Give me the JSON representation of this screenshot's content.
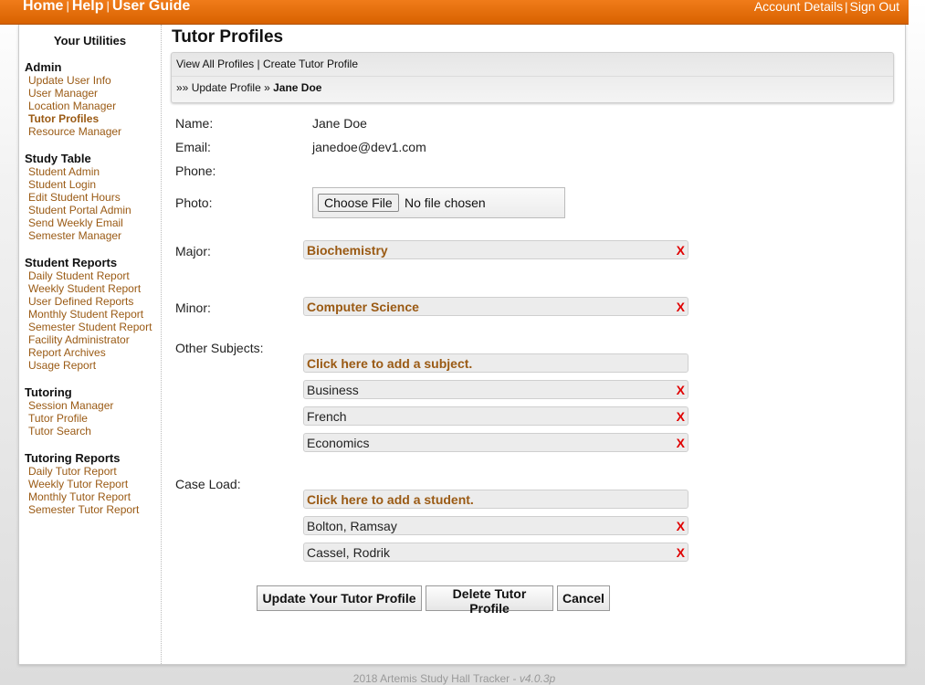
{
  "topbar": {
    "home": "Home",
    "help": "Help",
    "user_guide": "User Guide",
    "account_details": "Account Details",
    "sign_out": "Sign Out",
    "sep": "|"
  },
  "sidebar": {
    "title": "Your Utilities",
    "sections": [
      {
        "heading": "Admin",
        "items": [
          "Update User Info",
          "User Manager",
          "Location Manager",
          "Tutor Profiles",
          "Resource Manager"
        ]
      },
      {
        "heading": "Study Table",
        "items": [
          "Student Admin",
          "Student Login",
          "Edit Student Hours",
          "Student Portal Admin",
          "Send Weekly Email",
          "Semester Manager"
        ]
      },
      {
        "heading": "Student Reports",
        "items": [
          "Daily Student Report",
          "Weekly Student Report",
          "User Defined Reports",
          "Monthly Student Report",
          "Semester Student Report",
          "Facility Administrator",
          "Report Archives",
          "Usage Report"
        ]
      },
      {
        "heading": "Tutoring",
        "items": [
          "Session Manager",
          "Tutor Profile",
          "Tutor Search"
        ]
      },
      {
        "heading": "Tutoring Reports",
        "items": [
          "Daily Tutor Report",
          "Weekly Tutor Report",
          "Monthly Tutor Report",
          "Semester Tutor Report"
        ]
      }
    ]
  },
  "main": {
    "title": "Tutor Profiles",
    "nav": {
      "view_all": "View All Profiles",
      "sep": "|",
      "create": "Create Tutor Profile",
      "crumb_prefix": "»»",
      "crumb_update": "Update Profile",
      "crumb_arrow": "»",
      "crumb_current": "Jane Doe"
    },
    "fields": {
      "name_label": "Name:",
      "name_value": "Jane Doe",
      "email_label": "Email:",
      "email_value": "janedoe@dev1.com",
      "phone_label": "Phone:",
      "photo_label": "Photo:",
      "choose_file": "Choose File",
      "no_file": "No file chosen",
      "major_label": "Major:",
      "major_value": "Biochemistry",
      "minor_label": "Minor:",
      "minor_value": "Computer Science",
      "other_label": "Other Subjects:",
      "add_subject": "Click here to add a subject.",
      "subjects": [
        "Business",
        "French",
        "Economics"
      ],
      "caseload_label": "Case Load:",
      "add_student": "Click here to add a student.",
      "students": [
        "Bolton, Ramsay",
        "Cassel, Rodrik"
      ],
      "remove_glyph": "X"
    },
    "buttons": {
      "update": "Update Your Tutor Profile",
      "delete": "Delete Tutor Profile",
      "cancel": "Cancel"
    }
  },
  "footer": {
    "text": "2018 Artemis Study Hall Tracker - ",
    "version": "v4.0.3p"
  }
}
